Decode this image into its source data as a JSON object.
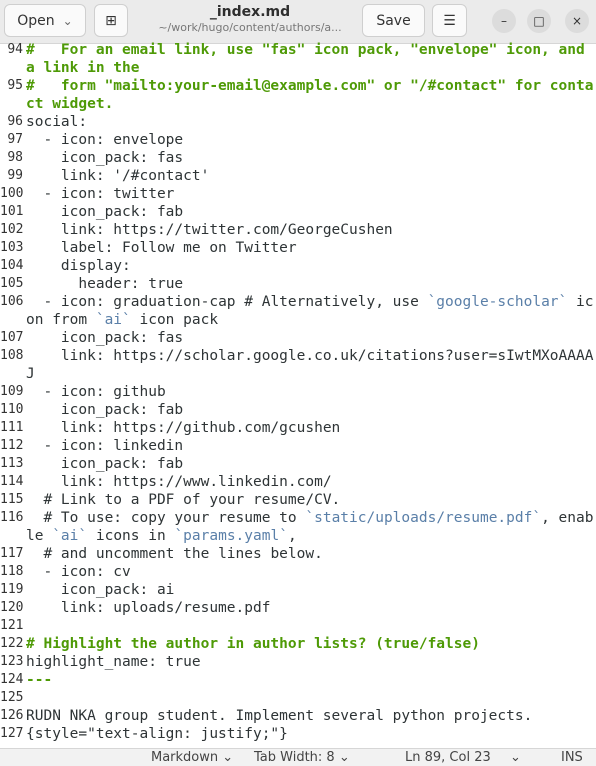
{
  "header": {
    "open_label": "Open",
    "open_chevron": "⌄",
    "new_tab_icon": "⊞",
    "title": "_index.md",
    "path": "~/work/hugo/content/authors/a...",
    "save_label": "Save",
    "menu_icon": "☰",
    "minimize": "–",
    "maximize": "□",
    "close": "×"
  },
  "lines": [
    {
      "n": "94",
      "s": [
        {
          "t": "#   For an email link, use \"fas\" icon pack, \"envelope\" icon, and a link in the",
          "c": "c"
        }
      ]
    },
    {
      "n": "95",
      "s": [
        {
          "t": "#   form \"mailto:your-email@example.com\" or \"/#contact\" for contact widget.",
          "c": "c"
        }
      ]
    },
    {
      "n": "96",
      "s": [
        {
          "t": "social:"
        }
      ]
    },
    {
      "n": "97",
      "s": [
        {
          "t": "  - icon: envelope"
        }
      ]
    },
    {
      "n": "98",
      "s": [
        {
          "t": "    icon_pack: fas"
        }
      ]
    },
    {
      "n": "99",
      "s": [
        {
          "t": "    link: '/#contact'"
        }
      ]
    },
    {
      "n": "100",
      "s": [
        {
          "t": "  - icon: twitter"
        }
      ]
    },
    {
      "n": "101",
      "s": [
        {
          "t": "    icon_pack: fab"
        }
      ]
    },
    {
      "n": "102",
      "s": [
        {
          "t": "    link: https://twitter.com/GeorgeCushen"
        }
      ]
    },
    {
      "n": "103",
      "s": [
        {
          "t": "    label: Follow me on Twitter"
        }
      ]
    },
    {
      "n": "104",
      "s": [
        {
          "t": "    display:"
        }
      ]
    },
    {
      "n": "105",
      "s": [
        {
          "t": "      header: true"
        }
      ]
    },
    {
      "n": "106",
      "s": [
        {
          "t": "  - icon: graduation-cap # Alternatively, use "
        },
        {
          "t": "`google-scholar`",
          "c": "code"
        },
        {
          "t": " icon from "
        },
        {
          "t": "`ai`",
          "c": "code"
        },
        {
          "t": " icon pack"
        }
      ]
    },
    {
      "n": "107",
      "s": [
        {
          "t": "    icon_pack: fas"
        }
      ]
    },
    {
      "n": "108",
      "s": [
        {
          "t": "    link: https://scholar.google.co.uk/citations?user=sIwtMXoAAAAJ"
        }
      ]
    },
    {
      "n": "109",
      "s": [
        {
          "t": "  - icon: github"
        }
      ]
    },
    {
      "n": "110",
      "s": [
        {
          "t": "    icon_pack: fab"
        }
      ]
    },
    {
      "n": "111",
      "s": [
        {
          "t": "    link: https://github.com/gcushen"
        }
      ]
    },
    {
      "n": "112",
      "s": [
        {
          "t": "  - icon: linkedin"
        }
      ]
    },
    {
      "n": "113",
      "s": [
        {
          "t": "    icon_pack: fab"
        }
      ]
    },
    {
      "n": "114",
      "s": [
        {
          "t": "    link: https://www.linkedin.com/"
        }
      ]
    },
    {
      "n": "115",
      "s": [
        {
          "t": "  # Link to a PDF of your resume/CV."
        }
      ]
    },
    {
      "n": "116",
      "s": [
        {
          "t": "  # To use: copy your resume to "
        },
        {
          "t": "`static/uploads/resume.pdf`",
          "c": "code"
        },
        {
          "t": ", enable "
        },
        {
          "t": "`ai`",
          "c": "code"
        },
        {
          "t": " icons in "
        },
        {
          "t": "`params.yaml`",
          "c": "code"
        },
        {
          "t": ","
        }
      ]
    },
    {
      "n": "117",
      "s": [
        {
          "t": "  # and uncomment the lines below."
        }
      ]
    },
    {
      "n": "118",
      "s": [
        {
          "t": "  - icon: cv"
        }
      ]
    },
    {
      "n": "119",
      "s": [
        {
          "t": "    icon_pack: ai"
        }
      ]
    },
    {
      "n": "120",
      "s": [
        {
          "t": "    link: uploads/resume.pdf"
        }
      ]
    },
    {
      "n": "121",
      "s": [
        {
          "t": ""
        }
      ]
    },
    {
      "n": "122",
      "s": [
        {
          "t": "# Highlight the author in author lists? (true/false)",
          "c": "c"
        }
      ]
    },
    {
      "n": "123",
      "s": [
        {
          "t": "highlight_name: true"
        }
      ]
    },
    {
      "n": "124",
      "s": [
        {
          "t": "---",
          "c": "c"
        }
      ]
    },
    {
      "n": "125",
      "s": [
        {
          "t": ""
        }
      ]
    },
    {
      "n": "126",
      "s": [
        {
          "t": "RUDN NKA group student. Implement several python projects."
        }
      ]
    },
    {
      "n": "127",
      "s": [
        {
          "t": "{style=\"text-align: justify;\"}"
        }
      ]
    }
  ],
  "status": {
    "language": "Markdown ⌄",
    "tab_width": "Tab Width: 8 ⌄",
    "position": "Ln 89, Col 23",
    "pos_chevron": "⌄",
    "mode": "INS"
  }
}
